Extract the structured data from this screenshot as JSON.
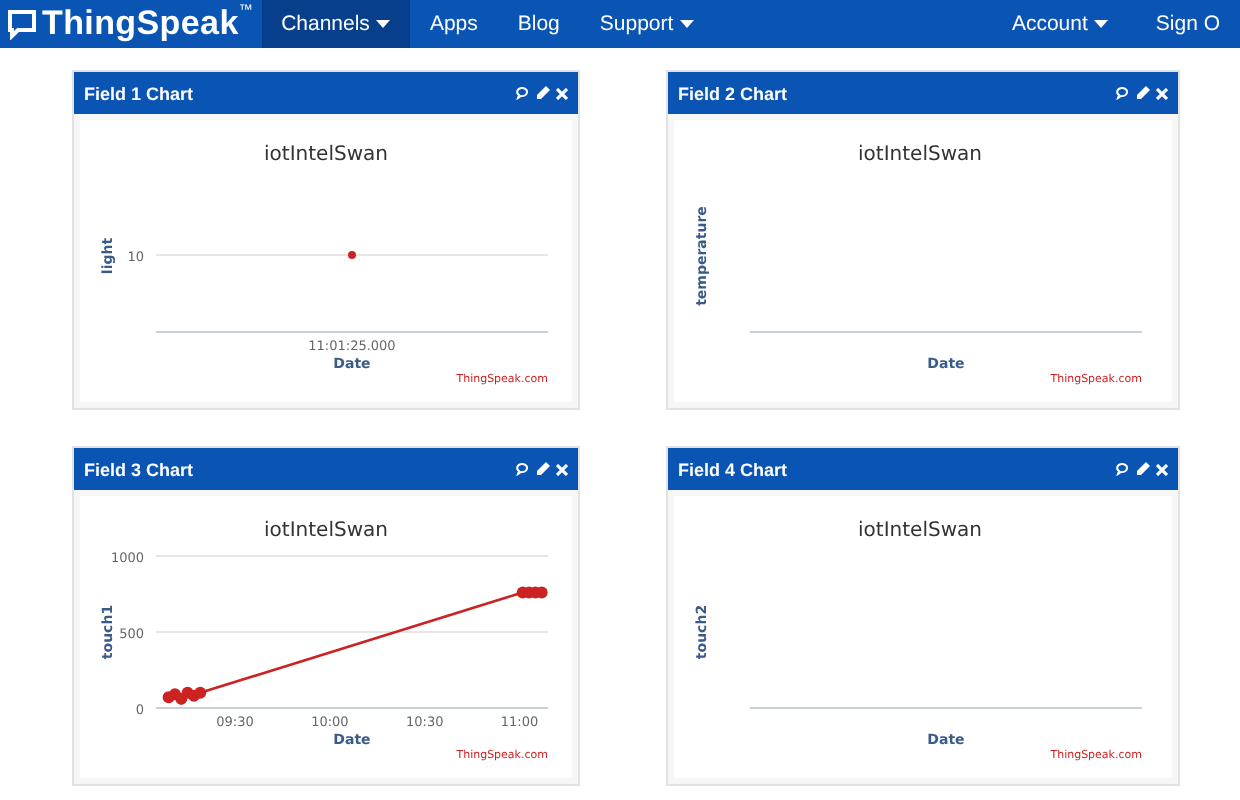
{
  "navbar": {
    "brand": "ThingSpeak",
    "trademark": "™",
    "items": [
      {
        "label": "Channels",
        "dropdown": true,
        "selected": true
      },
      {
        "label": "Apps",
        "dropdown": false,
        "selected": false
      },
      {
        "label": "Blog",
        "dropdown": false,
        "selected": false
      },
      {
        "label": "Support",
        "dropdown": true,
        "selected": false
      }
    ],
    "right_items": [
      {
        "label": "Account",
        "dropdown": true
      },
      {
        "label": "Sign O",
        "dropdown": false
      }
    ]
  },
  "cards": [
    {
      "title": "Field 1 Chart",
      "credit": "ThingSpeak.com",
      "chart_data": {
        "type": "other",
        "title": "iotIntelSwan",
        "xlabel": "Date",
        "ylabel": "light",
        "series": [
          {
            "color": "#cc2222",
            "marker": "circle"
          }
        ],
        "annotations": [
          {
            "text": "10"
          },
          {
            "text": "11:01:25.000"
          }
        ]
      }
    },
    {
      "title": "Field 2 Chart",
      "credit": "ThingSpeak.com",
      "chart_data": {
        "type": "other",
        "title": "iotIntelSwan",
        "xlabel": "Date",
        "ylabel": "temperature"
      }
    },
    {
      "title": "Field 3 Chart",
      "credit": "ThingSpeak.com",
      "chart_data": {
        "type": "line",
        "title": "iotIntelSwan",
        "xlabel": "Date",
        "ylabel": "touch1",
        "series": [
          {
            "color": "#cc2222",
            "marker": "circle",
            "x": [
              549,
              551,
              553,
              555,
              557,
              559,
              661,
              663,
              665,
              667
            ],
            "values": [
              70,
              90,
              60,
              100,
              80,
              100,
              760,
              760,
              760,
              760
            ]
          }
        ],
        "xlim": [
          545,
          669
        ],
        "ylim": [
          0,
          1000
        ],
        "xticks": [
          {
            "value": 570,
            "label": "09:30"
          },
          {
            "value": 600,
            "label": "10:00"
          },
          {
            "value": 630,
            "label": "10:30"
          },
          {
            "value": 660,
            "label": "11:00"
          }
        ],
        "yticks": [
          0,
          500,
          1000
        ]
      }
    },
    {
      "title": "Field 4 Chart",
      "credit": "ThingSpeak.com",
      "chart_data": {
        "type": "other",
        "title": "iotIntelSwan",
        "xlabel": "Date",
        "ylabel": "touch2"
      }
    }
  ]
}
